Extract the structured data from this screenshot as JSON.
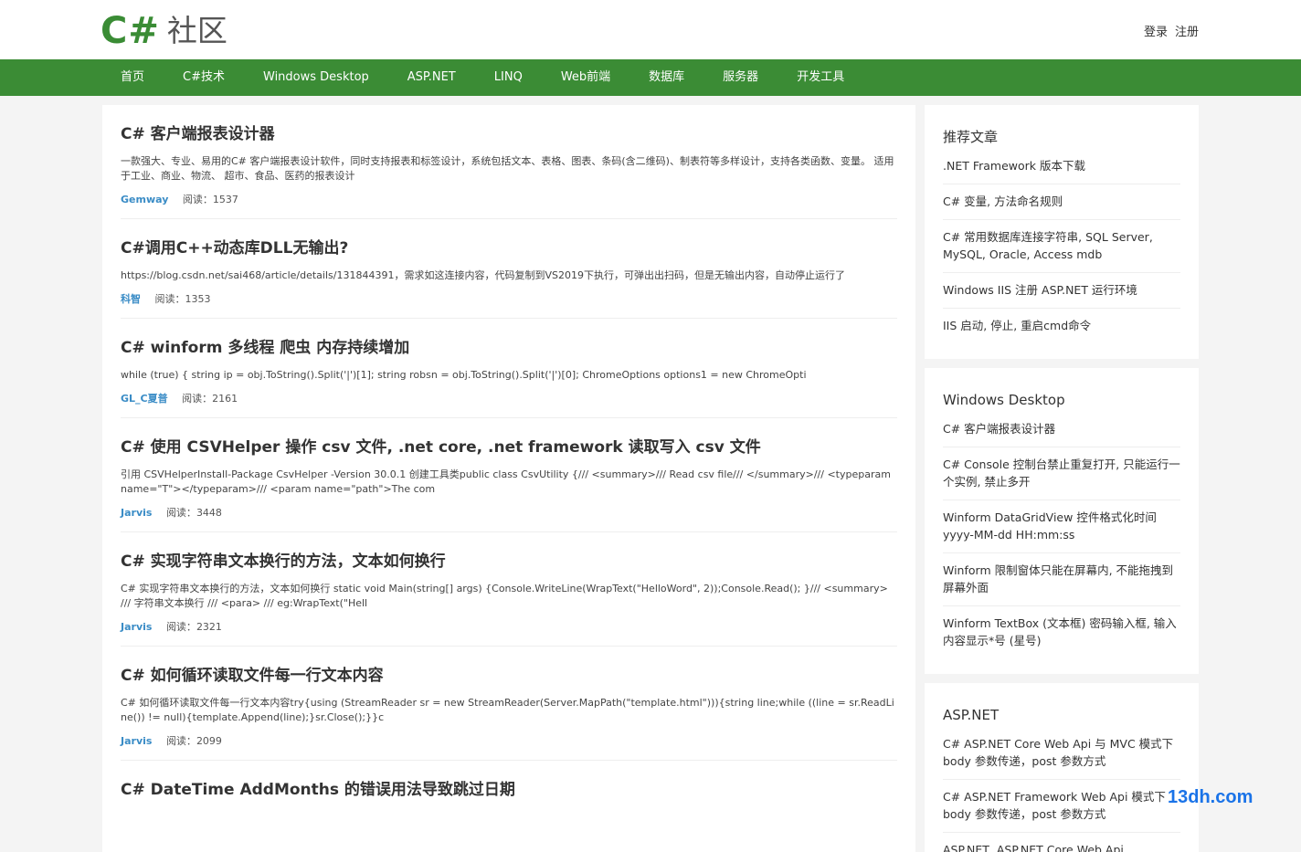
{
  "header": {
    "logo_cs": "C#",
    "logo_text": "社区",
    "login": "登录",
    "register": "注册"
  },
  "nav": {
    "items": [
      "首页",
      "C#技术",
      "Windows Desktop",
      "ASP.NET",
      "LINQ",
      "Web前端",
      "数据库",
      "服务器",
      "开发工具"
    ]
  },
  "articles": [
    {
      "title": "C# 客户端报表设计器",
      "summary": "一款强大、专业、易用的C# 客户端报表设计软件，同时支持报表和标签设计，系统包括文本、表格、图表、条码(含二维码)、制表符等多样设计，支持各类函数、变量。 适用于工业、商业、物流、 超市、食品、医药的报表设计",
      "author": "Gemway",
      "reads_label": "阅读：",
      "reads": "1537"
    },
    {
      "title": "C#调用C++动态库DLL无输出?",
      "summary": "https://blog.csdn.net/sai468/article/details/131844391，需求如这连接内容，代码复制到VS2019下执行，可弹出出扫码，但是无输出内容，自动停止运行了",
      "author": "科智",
      "reads_label": "阅读：",
      "reads": "1353"
    },
    {
      "title": "C# winform 多线程 爬虫 内存持续增加",
      "summary": "while (true) { string ip = obj.ToString().Split('|')[1]; string robsn = obj.ToString().Split('|')[0]; ChromeOptions options1 = new ChromeOpti",
      "author": "GL_C夏普",
      "reads_label": "阅读：",
      "reads": "2161"
    },
    {
      "title": "C# 使用 CSVHelper 操作 csv 文件, .net core, .net framework 读取写入 csv 文件",
      "summary": "引用 CSVHelperInstall-Package CsvHelper -Version 30.0.1 创建工具类public class CsvUtility {/// <summary>/// Read csv file/// </summary>/// <typeparam name=\"T\"></typeparam>/// <param name=\"path\">The com",
      "author": "Jarvis",
      "reads_label": "阅读：",
      "reads": "3448"
    },
    {
      "title": "C# 实现字符串文本换行的方法，文本如何换行",
      "summary": "C# 实现字符串文本换行的方法，文本如何换行 static void Main(string[] args) {Console.WriteLine(WrapText(\"HelloWord\", 2));Console.Read(); }/// <summary> /// 字符串文本换行 /// <para> /// eg:WrapText(\"Hell",
      "author": "Jarvis",
      "reads_label": "阅读：",
      "reads": "2321"
    },
    {
      "title": "C# 如何循环读取文件每一行文本内容",
      "summary": "C# 如何循环读取文件每一行文本内容try{using (StreamReader sr = new StreamReader(Server.MapPath(\"template.html\"))){string line;while ((line = sr.ReadLine()) != null){template.Append(line);}sr.Close();}}c",
      "author": "Jarvis",
      "reads_label": "阅读：",
      "reads": "2099"
    },
    {
      "title": "C# DateTime AddMonths 的错误用法导致跳过日期",
      "summary": "",
      "author": "",
      "reads_label": "",
      "reads": ""
    }
  ],
  "sidebar": [
    {
      "title": "推荐文章",
      "items": [
        ".NET Framework 版本下载",
        "C# 变量, 方法命名规则",
        "C# 常用数据库连接字符串, SQL Server, MySQL, Oracle, Access mdb",
        "Windows IIS 注册 ASP.NET 运行环境",
        "IIS 启动, 停止, 重启cmd命令"
      ]
    },
    {
      "title": "Windows Desktop",
      "items": [
        "C# 客户端报表设计器",
        "C# Console 控制台禁止重复打开, 只能运行一个实例, 禁止多开",
        "Winform DataGridView 控件格式化时间 yyyy-MM-dd HH:mm:ss",
        "Winform 限制窗体只能在屏幕内, 不能拖拽到屏幕外面",
        "Winform TextBox (文本框) 密码输入框, 输入内容显示*号 (星号)"
      ]
    },
    {
      "title": "ASP.NET",
      "items": [
        "C# ASP.NET Core Web Api 与 MVC 模式下 body 参数传递，post 参数方式",
        "C# ASP.NET Framework Web Api 模式下 body 参数传递，post 参数方式",
        "ASP.NET, ASP.NET Core Web Api"
      ]
    }
  ],
  "watermark": "13dh.com"
}
